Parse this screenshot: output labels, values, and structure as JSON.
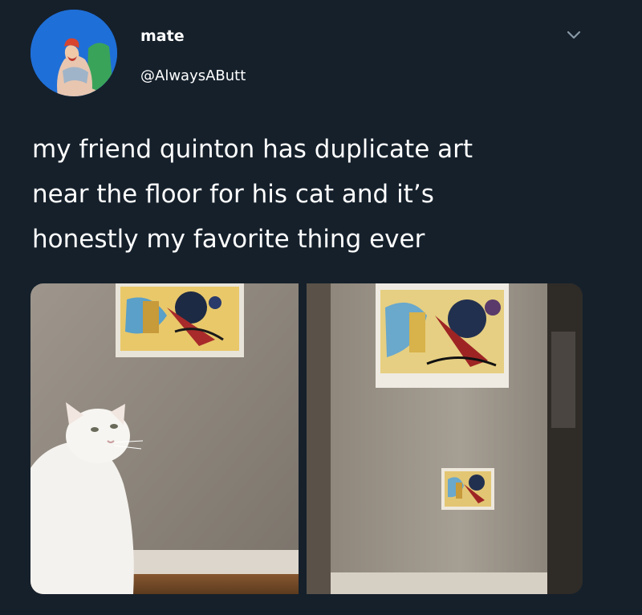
{
  "author": {
    "display_name": "mate",
    "handle": "@AlwaysAButt",
    "avatar_icon": "avatar-illustration"
  },
  "tweet": {
    "text": "my friend quinton has duplicate art\nnear the floor for his cat and it’s\nhonestly my favorite thing ever"
  },
  "menu_icon": "chevron-down-icon",
  "colors": {
    "background": "#15202b",
    "text": "#ffffff",
    "chevron": "#8899a6"
  }
}
